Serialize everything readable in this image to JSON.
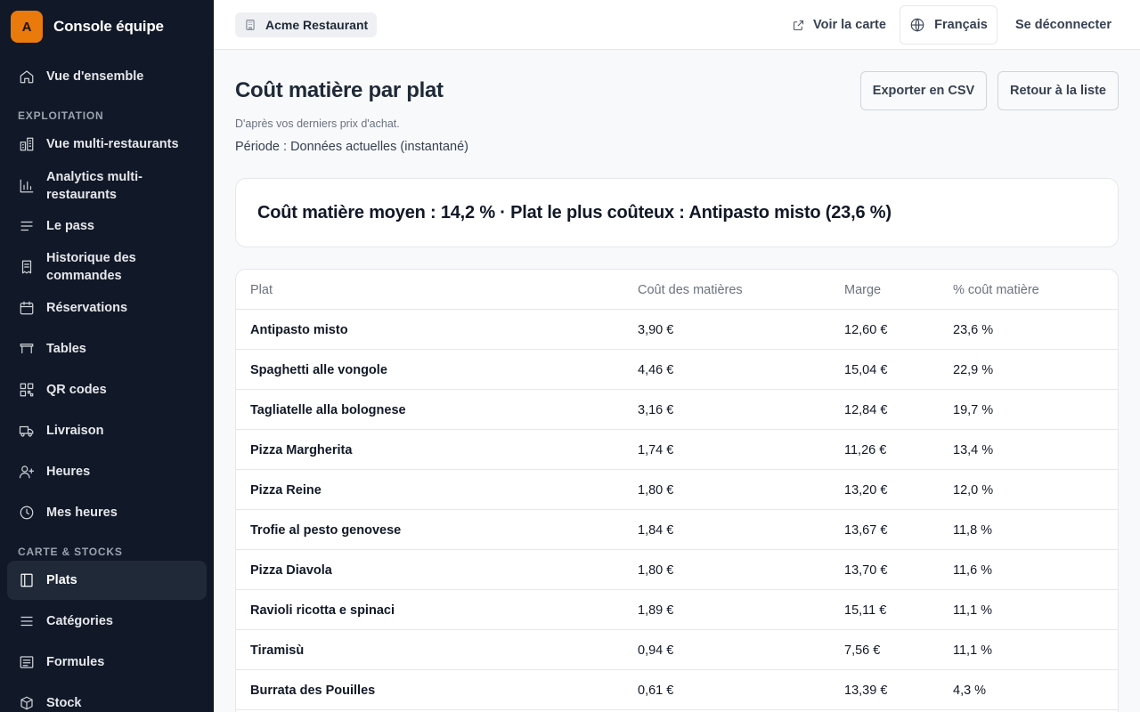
{
  "app": {
    "logo_letter": "A",
    "name": "Console équipe"
  },
  "sidebar": {
    "top_item": {
      "label": "Vue d'ensemble",
      "icon": "home-icon"
    },
    "sections": [
      {
        "title": "EXPLOITATION",
        "items": [
          {
            "label": "Vue multi-restaurants",
            "icon": "buildings-icon"
          },
          {
            "label": "Analytics multi-restaurants",
            "icon": "bar-chart-icon"
          },
          {
            "label": "Le pass",
            "icon": "list-lines-icon"
          },
          {
            "label": "Historique des commandes",
            "icon": "receipt-icon"
          },
          {
            "label": "Réservations",
            "icon": "calendar-icon"
          },
          {
            "label": "Tables",
            "icon": "table-icon"
          },
          {
            "label": "QR codes",
            "icon": "qr-code-icon"
          },
          {
            "label": "Livraison",
            "icon": "truck-icon"
          },
          {
            "label": "Heures",
            "icon": "user-plus-icon"
          },
          {
            "label": "Mes heures",
            "icon": "clock-icon"
          }
        ]
      },
      {
        "title": "CARTE & STOCKS",
        "items": [
          {
            "label": "Plats",
            "icon": "book-icon",
            "active": true
          },
          {
            "label": "Catégories",
            "icon": "menu-lines-icon"
          },
          {
            "label": "Formules",
            "icon": "list-box-icon"
          },
          {
            "label": "Stock",
            "icon": "box-icon"
          }
        ]
      }
    ]
  },
  "topbar": {
    "restaurant": "Acme Restaurant",
    "view_menu": "Voir la carte",
    "language": "Français",
    "logout": "Se déconnecter"
  },
  "page": {
    "title": "Coût matière par plat",
    "subtitle": "D'après vos derniers prix d'achat.",
    "period": "Période : Données actuelles (instantané)",
    "export_button": "Exporter en CSV",
    "back_button": "Retour à la liste",
    "summary": "Coût matière moyen : 14,2 % · Plat le plus coûteux : Antipasto misto (23,6 %)"
  },
  "table": {
    "headers": [
      "Plat",
      "Coût des matières",
      "Marge",
      "% coût matière"
    ],
    "rows": [
      [
        "Antipasto misto",
        "3,90 €",
        "12,60 €",
        "23,6 %"
      ],
      [
        "Spaghetti alle vongole",
        "4,46 €",
        "15,04 €",
        "22,9 %"
      ],
      [
        "Tagliatelle alla bolognese",
        "3,16 €",
        "12,84 €",
        "19,7 %"
      ],
      [
        "Pizza Margherita",
        "1,74 €",
        "11,26 €",
        "13,4 %"
      ],
      [
        "Pizza Reine",
        "1,80 €",
        "13,20 €",
        "12,0 %"
      ],
      [
        "Trofie al pesto genovese",
        "1,84 €",
        "13,67 €",
        "11,8 %"
      ],
      [
        "Pizza Diavola",
        "1,80 €",
        "13,70 €",
        "11,6 %"
      ],
      [
        "Ravioli ricotta e spinaci",
        "1,89 €",
        "15,11 €",
        "11,1 %"
      ],
      [
        "Tiramisù",
        "0,94 €",
        "7,56 €",
        "11,1 %"
      ],
      [
        "Burrata des Pouilles",
        "0,61 €",
        "13,39 €",
        "4,3 %"
      ]
    ]
  }
}
